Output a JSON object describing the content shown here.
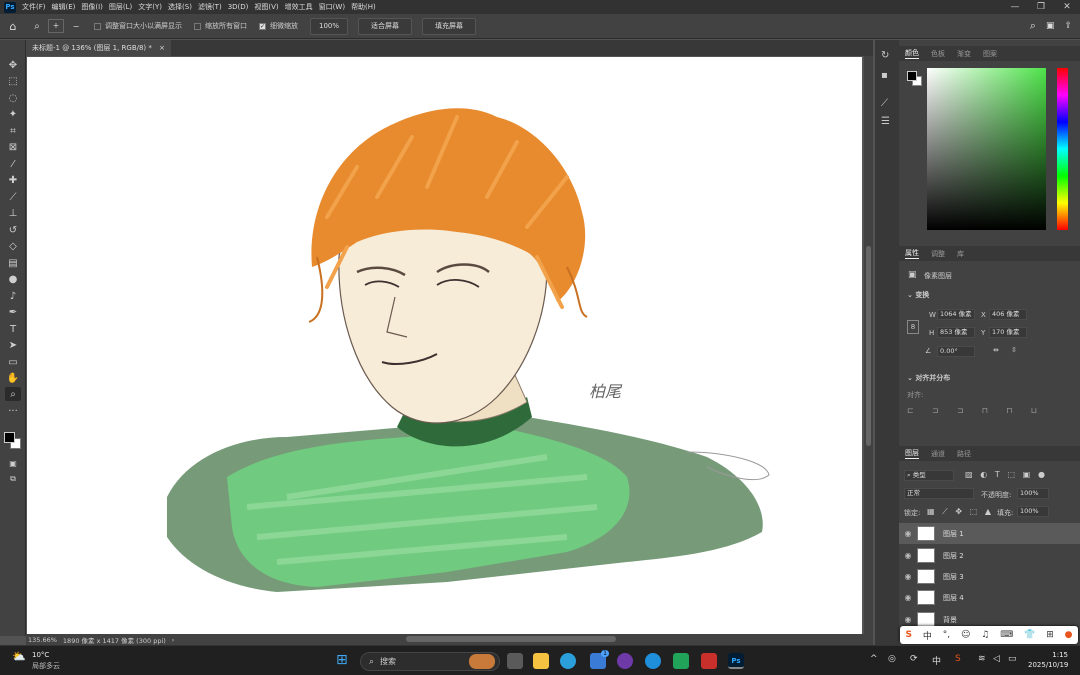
{
  "app": {
    "logo": "Ps"
  },
  "menu": [
    "文件(F)",
    "编辑(E)",
    "图像(I)",
    "图层(L)",
    "文字(Y)",
    "选择(S)",
    "滤镜(T)",
    "3D(D)",
    "视图(V)",
    "增效工具",
    "窗口(W)",
    "帮助(H)"
  ],
  "window_controls": {
    "minimize": "—",
    "restore": "❐",
    "close": "✕"
  },
  "options_bar": {
    "resize_windows": "调整窗口大小以满屏显示",
    "zoom_all_windows": "缩放所有窗口",
    "scrubby_zoom": "细微缩放",
    "zoom_value": "100%",
    "fit_screen": "适合屏幕",
    "fill_screen": "填充屏幕"
  },
  "document_tab": {
    "title": "未标题-1 @ 136% (图层 1, RGB/8) *",
    "close": "×"
  },
  "status_bar": {
    "zoom": "135.66%",
    "info": "1890 像素 x 1417 像素 (300 ppi)",
    "arrow": "›"
  },
  "signature_text": "柏尾",
  "color_panel": {
    "tabs": [
      "颜色",
      "色板",
      "渐变",
      "图案"
    ],
    "active": 0
  },
  "properties_panel": {
    "tabs": [
      "属性",
      "调整",
      "库"
    ],
    "active": 0,
    "kind": "像素图层",
    "transform_title": "变换",
    "w_label": "W",
    "w": "1064 像素",
    "x_label": "X",
    "x": "406 像素",
    "h_label": "H",
    "h": "853 像素",
    "y_label": "Y",
    "y": "170 像素",
    "angle": "0.00°",
    "align_title": "对齐并分布",
    "align_label": "对齐:"
  },
  "layers_panel": {
    "tabs": [
      "图层",
      "通道",
      "路径"
    ],
    "active": 0,
    "filter_kind": "类型",
    "blend_mode": "正常",
    "opacity_label": "不透明度:",
    "opacity": "100%",
    "lock_label": "锁定:",
    "fill_label": "填充:",
    "fill": "100%",
    "layers": [
      {
        "name": "图层 1",
        "selected": true
      },
      {
        "name": "图层 2",
        "selected": false
      },
      {
        "name": "图层 3",
        "selected": false
      },
      {
        "name": "图层 4",
        "selected": false
      },
      {
        "name": "背景",
        "selected": false
      }
    ]
  },
  "taskbar": {
    "weather_temp": "10°C",
    "weather_desc": "局部多云",
    "search": "搜索",
    "ime_lang": "中",
    "time": "1:15",
    "date": "2025/10/19",
    "store_badge": "1"
  },
  "colors": {
    "hair": "#e88a2e",
    "shirt": "#6fcf7f",
    "shirt_dark": "#5f8a62",
    "skin": "#f7ecd7",
    "accent": "#31a8ff"
  }
}
